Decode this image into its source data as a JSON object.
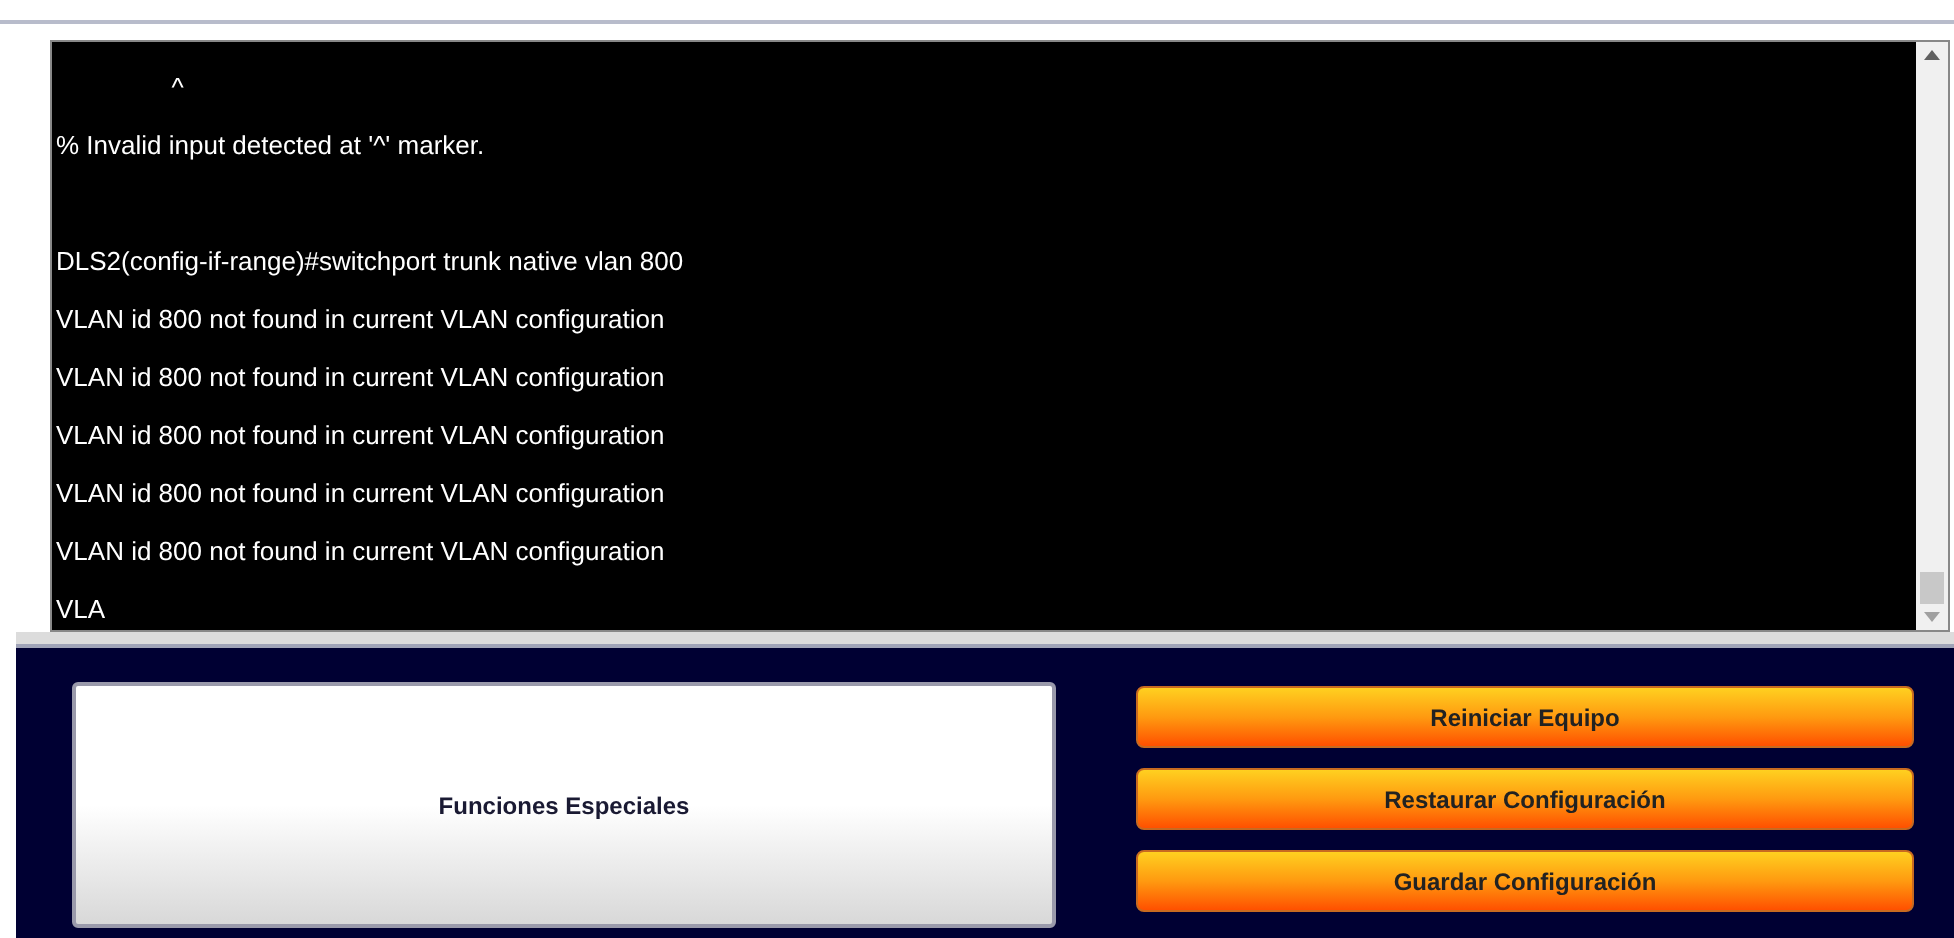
{
  "terminal": {
    "blocks": [
      [
        "                ^",
        "% Invalid input detected at '^' marker."
      ],
      [
        "DLS2(config-if-range)#switchport trunk native vlan 800",
        "VLAN id 800 not found in current VLAN configuration",
        "VLAN id 800 not found in current VLAN configuration",
        "VLAN id 800 not found in current VLAN configuration",
        "VLAN id 800 not found in current VLAN configuration",
        "VLAN id 800 not found in current VLAN configuration",
        "VLA"
      ]
    ]
  },
  "special_panel": {
    "label": "Funciones Especiales"
  },
  "buttons": [
    "Reiniciar Equipo",
    "Restaurar Configuración",
    "Guardar Configuración"
  ]
}
